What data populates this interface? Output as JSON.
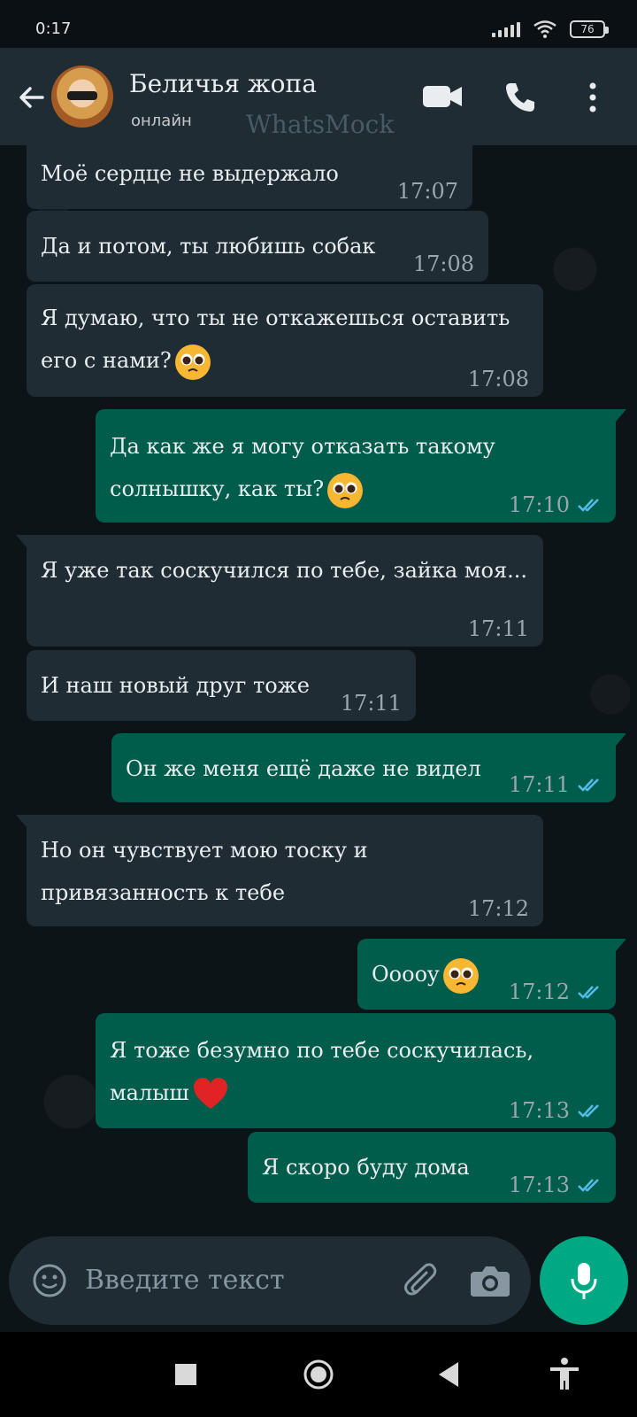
{
  "status_bar": {
    "time": "0:17",
    "battery": "76"
  },
  "header": {
    "contact_name": "Беличья жопа",
    "contact_status": "онлайн",
    "watermark": "WhatsMock"
  },
  "messages": [
    {
      "direction": "incoming",
      "text": "Моё сердце не выдержало",
      "time": "17:07",
      "emoji": ""
    },
    {
      "direction": "incoming",
      "text": "Да и потом, ты любишь собак",
      "time": "17:08",
      "emoji": ""
    },
    {
      "direction": "incoming",
      "text": "Я думаю, что ты не откажешься оставить его с нами?",
      "time": "17:08",
      "emoji": "pleading-face"
    },
    {
      "direction": "outgoing",
      "text": "Да как же я могу отказать такому солнышку, как ты?",
      "time": "17:10",
      "emoji": "pleading-face",
      "status": "read"
    },
    {
      "direction": "incoming",
      "text": "Я уже так соскучился по тебе, зайка моя...",
      "time": "17:11",
      "emoji": ""
    },
    {
      "direction": "incoming",
      "text": "И наш новый друг тоже",
      "time": "17:11",
      "emoji": ""
    },
    {
      "direction": "outgoing",
      "text": "Он же меня ещё даже не видел",
      "time": "17:11",
      "emoji": "",
      "status": "read"
    },
    {
      "direction": "incoming",
      "text": "Но он чувствует мою тоску и привязанность к тебе",
      "time": "17:12",
      "emoji": ""
    },
    {
      "direction": "outgoing",
      "text": "Ooooy",
      "time": "17:12",
      "emoji": "pleading-face",
      "status": "read"
    },
    {
      "direction": "outgoing",
      "text": "Я тоже безумно по тебе соскучилась, малыш",
      "time": "17:13",
      "emoji": "red-heart",
      "status": "read"
    },
    {
      "direction": "outgoing",
      "text": "Я скоро буду дома",
      "time": "17:13",
      "emoji": "",
      "status": "read"
    }
  ],
  "composer": {
    "placeholder": "Введите текст"
  },
  "colors": {
    "header_bg": "#1f2c34",
    "chat_bg": "#0d1418",
    "incoming_bubble": "#1f2c34",
    "outgoing_bubble": "#005c4b",
    "accent": "#00a884",
    "read_tick": "#53bdeb"
  },
  "icons": {
    "back": "arrow-left-icon",
    "video": "video-call-icon",
    "call": "phone-icon",
    "menu": "more-vert-icon",
    "emoji": "emoji-icon",
    "attach": "paperclip-icon",
    "camera": "camera-icon",
    "mic": "mic-icon"
  }
}
